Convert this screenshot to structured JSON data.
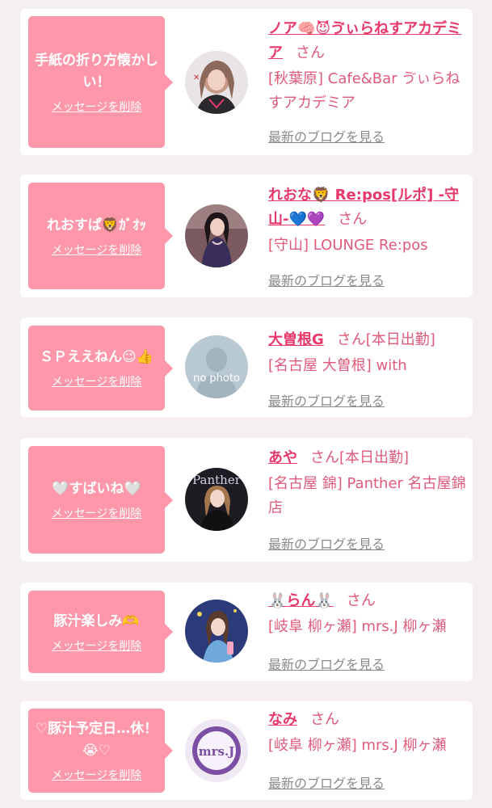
{
  "colors": {
    "accent": "#e7386a",
    "bubble": "#fd97a9",
    "gray_link": "#8a8a8a"
  },
  "delete_label": "メッセージを削除",
  "blog_label": "最新のブログを見る",
  "suffix": "さん",
  "items": [
    {
      "message": "手紙の折り方懐かしい！",
      "name": "ノア🧠😈ゔぃらねすアカデミア",
      "status": "",
      "shop": "[秋葉原] Cafe&Bar ゔぃらねすアカデミア"
    },
    {
      "message": "れおすぱ🦁ｶﾞｵｯ",
      "name": "れおな🦁 Re:pos[ルポ] -守山-💙💜",
      "status": "",
      "shop": "[守山] LOUNGE Re:pos"
    },
    {
      "message": "ＳＰええねん😉👍",
      "name": "大曽根G",
      "status": "[本日出勤]",
      "shop": "[名古屋 大曽根] with",
      "avatar_text": "no photo"
    },
    {
      "message": "🤍すばいね🤍",
      "name": "あや",
      "status": "[本日出勤]",
      "shop": "[名古屋 錦] Panther 名古屋錦店",
      "avatar_text": "Panther"
    },
    {
      "message": "豚汁楽しみ🫶",
      "name": "🐰らん🐰",
      "status": "",
      "shop": "[岐阜 柳ヶ瀬] mrs.J 柳ヶ瀬"
    },
    {
      "message": "♡豚汁予定日…休！😭♡",
      "name": "なみ",
      "status": "",
      "shop": "[岐阜 柳ヶ瀬] mrs.J 柳ヶ瀬",
      "avatar_text": "mrs.J"
    }
  ]
}
